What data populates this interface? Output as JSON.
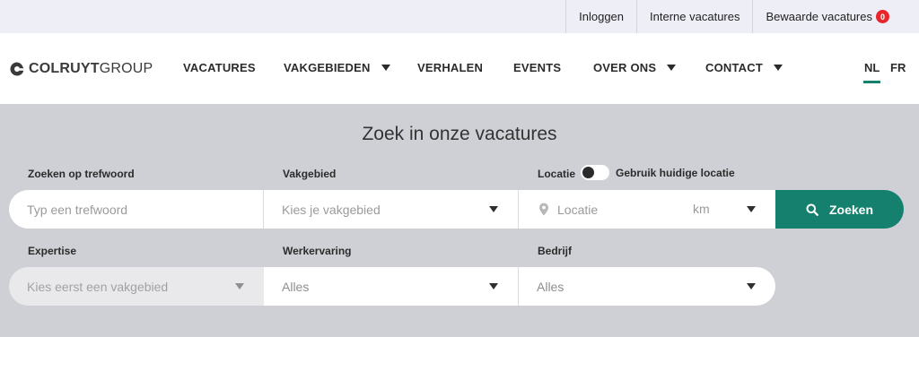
{
  "topbar": {
    "login": "Inloggen",
    "internal": "Interne vacatures",
    "saved": "Bewaarde vacatures",
    "saved_count": "0"
  },
  "logo": {
    "bold": "COLRUYT",
    "light": "GROUP"
  },
  "nav": {
    "vacatures": "VACATURES",
    "vakgebieden": "VAKGEBIEDEN",
    "verhalen": "VERHALEN",
    "events": "EVENTS",
    "over_ons": "OVER ONS",
    "contact": "CONTACT",
    "lang_nl": "NL",
    "lang_fr": "FR"
  },
  "search": {
    "title": "Zoek in onze vacatures",
    "keyword_label": "Zoeken op trefwoord",
    "keyword_placeholder": "Typ een trefwoord",
    "domain_label": "Vakgebied",
    "domain_placeholder": "Kies je vakgebied",
    "location_label": "Locatie",
    "use_location_label": "Gebruik huidige locatie",
    "location_placeholder": "Locatie",
    "km": "km",
    "search_button": "Zoeken",
    "expertise_label": "Expertise",
    "expertise_placeholder": "Kies eerst een vakgebied",
    "experience_label": "Werkervaring",
    "experience_value": "Alles",
    "company_label": "Bedrijf",
    "company_value": "Alles"
  },
  "colors": {
    "accent": "#16806e",
    "badge": "#e8272c",
    "panel": "#cfd0d6"
  }
}
